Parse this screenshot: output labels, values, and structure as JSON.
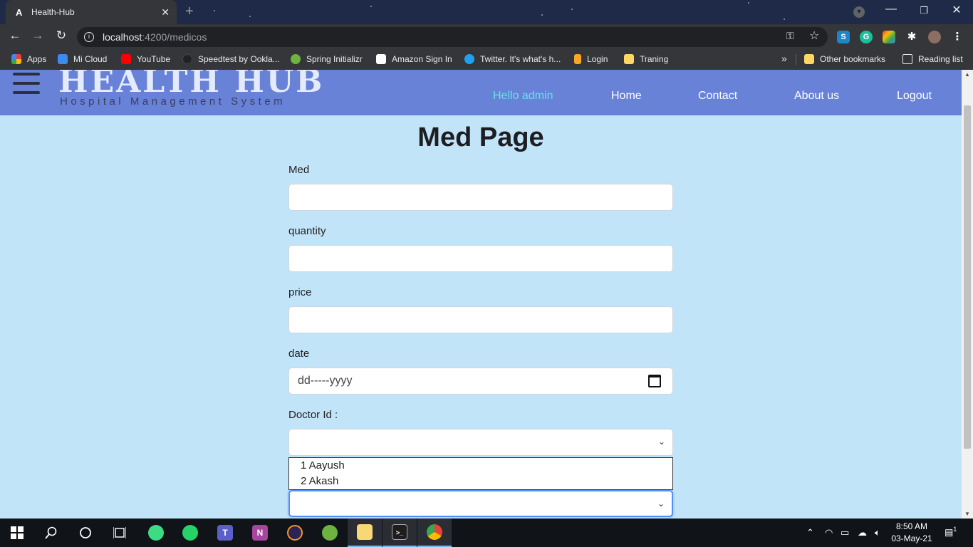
{
  "browser": {
    "tab_title": "Health-Hub",
    "tab_favicon": "A",
    "tab_close": "✕",
    "new_tab": "+",
    "url_host": "localhost",
    "url_path": ":4200/medicos",
    "bookmarks": [
      {
        "label": "Apps",
        "icon_color": "#ea4335"
      },
      {
        "label": "Mi Cloud",
        "icon_color": "#3c8cf0"
      },
      {
        "label": "YouTube",
        "icon_color": "#ff0000"
      },
      {
        "label": "Speedtest by Ookla...",
        "icon_color": "#202124"
      },
      {
        "label": "Spring Initializr",
        "icon_color": "#6db33f"
      },
      {
        "label": "Amazon Sign In",
        "icon_color": "#ffffff"
      },
      {
        "label": "Twitter. It's what's h...",
        "icon_color": "#1da1f2"
      },
      {
        "label": "Login",
        "icon_color": "#f9a825"
      },
      {
        "label": "Traning",
        "icon_color": "#fdd663"
      }
    ],
    "bookmarks_overflow": "»",
    "other_bookmarks": "Other bookmarks",
    "reading_list": "Reading list"
  },
  "app": {
    "brand_title": "HEALTH HUB",
    "brand_subtitle": "Hospital Management System",
    "nav": {
      "hello": "Hello admin",
      "home": "Home",
      "contact": "Contact",
      "about": "About us",
      "logout": "Logout"
    }
  },
  "form": {
    "heading": "Med Page",
    "med_label": "Med",
    "med_value": "",
    "quantity_label": "quantity",
    "quantity_value": "",
    "price_label": "price",
    "price_value": "",
    "date_label": "date",
    "date_placeholder": "dd-----yyyy",
    "doctor_label": "Doctor Id :",
    "doctor_value": "",
    "doctor_options": [
      "1 Aayush",
      "2 Akash"
    ],
    "second_select_value": ""
  },
  "taskbar": {
    "apps": [
      {
        "name": "android-studio-icon",
        "color": "#3ddc84"
      },
      {
        "name": "whatsapp-icon",
        "color": "#25d366"
      },
      {
        "name": "teams-icon",
        "color": "#5b5fc7"
      },
      {
        "name": "onenote-icon",
        "color": "#a8459f"
      },
      {
        "name": "eclipse-icon",
        "color": "#2c2255"
      },
      {
        "name": "spring-tool-suite-icon",
        "color": "#6db33f"
      },
      {
        "name": "file-explorer-icon",
        "color": "#f8d775"
      },
      {
        "name": "terminal-icon",
        "color": "#1e1e1e"
      },
      {
        "name": "chrome-icon",
        "color": "#e94235"
      }
    ],
    "time": "8:50 AM",
    "date": "03-May-21",
    "notification_count": "1"
  }
}
